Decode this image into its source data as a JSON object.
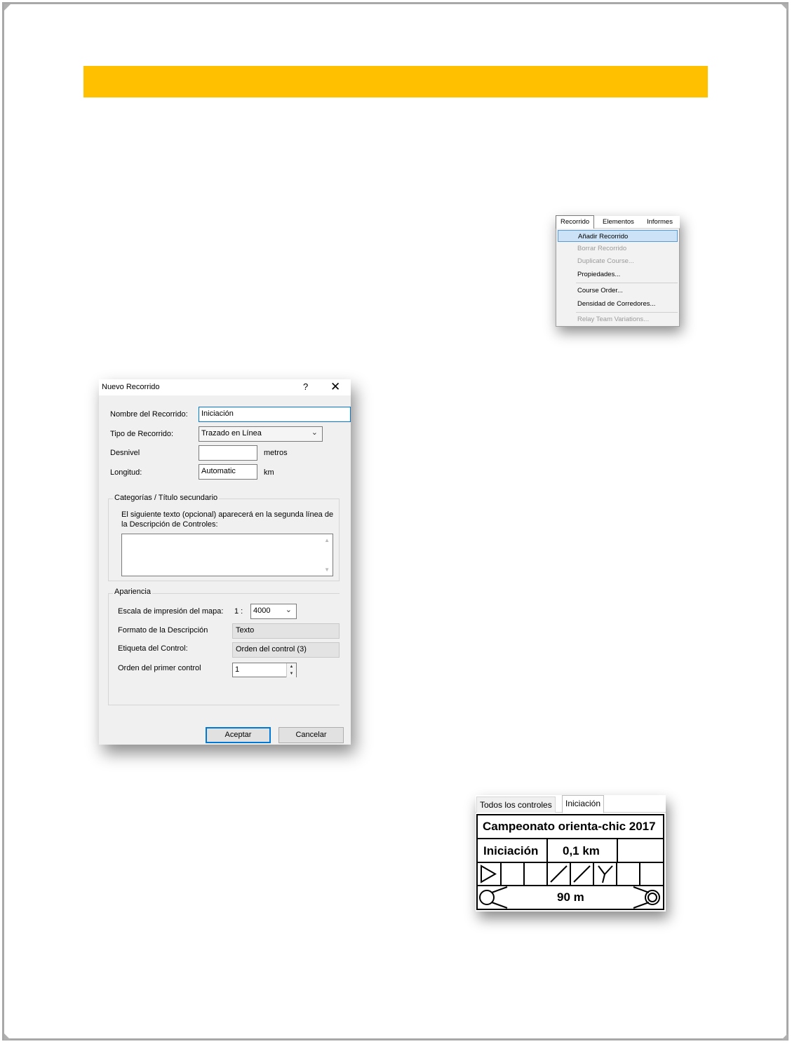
{
  "page": {
    "banner_color": "#ffc000",
    "border_color": "#a8a8a8"
  },
  "menu": {
    "tabs": [
      "Recorrido",
      "Elementos",
      "Informes"
    ],
    "items": [
      {
        "label": "Añadir Recorrido",
        "enabled": true,
        "highlighted": true
      },
      {
        "label": "Borrar Recorrido",
        "enabled": false
      },
      {
        "label": "Duplicate Course...",
        "enabled": false
      },
      {
        "label": "Propiedades...",
        "enabled": true
      },
      {
        "label": "Course Order...",
        "enabled": true
      },
      {
        "label": "Densidad de Corredores...",
        "enabled": true
      },
      {
        "label": "Relay Team Variations...",
        "enabled": false
      }
    ]
  },
  "dialog": {
    "title": "Nuevo Recorrido",
    "help_glyph": "?",
    "close_glyph": "✕",
    "name_label": "Nombre del Recorrido:",
    "name_value": "Iniciación",
    "type_label": "Tipo de Recorrido:",
    "type_value": "Trazado en Línea",
    "climb_label": "Desnivel",
    "climb_value": "",
    "climb_unit": "metros",
    "length_label": "Longitud:",
    "length_value": "Automatic",
    "length_unit": "km",
    "secondary_group": "Categorías / Título secundario",
    "secondary_help": "El siguiente texto (opcional) aparecerá en la segunda línea de la Descripción de Controles:",
    "secondary_value": "",
    "appearance_group": "Apariencia",
    "scale_label": "Escala de impresión del mapa:",
    "scale_prefix": "1 :",
    "scale_value": "4000",
    "format_label": "Formato de la Descripción",
    "format_value": "Texto",
    "control_label_label": "Etiqueta del Control:",
    "control_label_value": "Orden del control (3)",
    "first_control_label": "Orden del primer control",
    "first_control_value": "1",
    "ok_label": "Aceptar",
    "cancel_label": "Cancelar"
  },
  "description": {
    "tabs": [
      "Todos los controles",
      "Iniciación"
    ],
    "active_tab": "Iniciación",
    "event_title": "Campeonato orienta-chic 2017",
    "course_name": "Iniciación",
    "course_length": "0,1 km",
    "finish_distance": "90 m",
    "symbols": [
      "start-triangle",
      "empty",
      "empty",
      "slash",
      "slash",
      "y-junction",
      "empty",
      "empty"
    ]
  }
}
